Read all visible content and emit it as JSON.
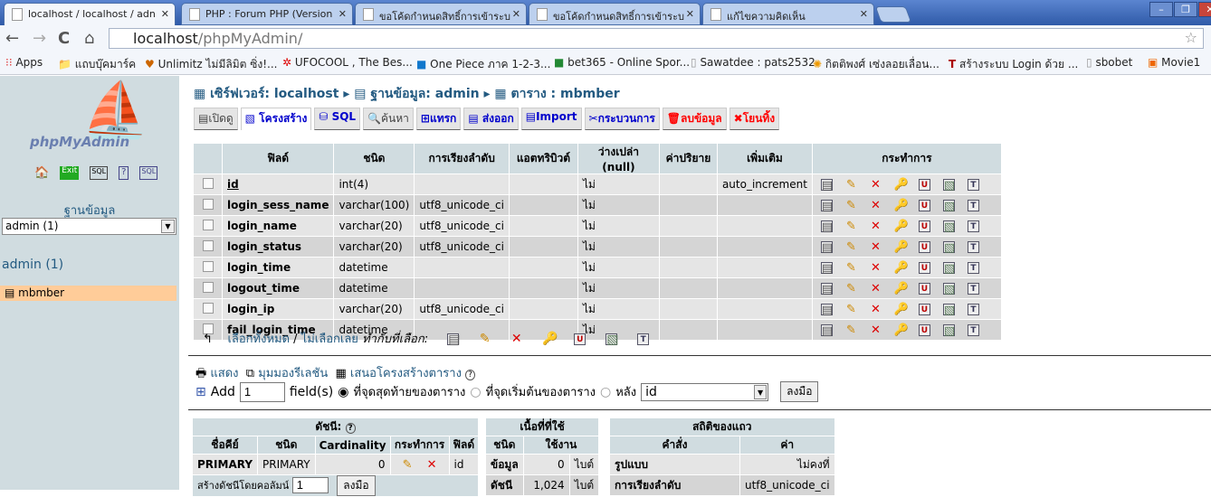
{
  "browser": {
    "tabs": [
      {
        "title": "localhost / localhost / adn",
        "active": true
      },
      {
        "title": "PHP : Forum PHP (Version"
      },
      {
        "title": "ขอโค้ดกำหนดสิทธิ์การเข้าระบ"
      },
      {
        "title": "ขอโค้ดกำหนดสิทธิ์การเข้าระบ"
      },
      {
        "title": "แก้ไขความคิดเห็น"
      }
    ],
    "url_host": "localhost",
    "url_path": "/phpMyAdmin/",
    "bookmarks": [
      "Apps",
      "แถบบุ๊คมาร์ค",
      "Unlimitz ไม่มีลิมิต ซิ่ง!...",
      "UFOCOOL , The Bes...",
      "One Piece ภาค 1-2-3...",
      "bet365 - Online Spor...",
      "Sawatdee : pats2532",
      "กิตติพงศ์ เซ่งลอยเลื่อน...",
      "สร้างระบบ Login ด้วย ...",
      "sbobet",
      "Movie1"
    ]
  },
  "sidebar": {
    "logo": "phpMyAdmin",
    "db_label": "ฐานข้อมูล",
    "db_select": "admin (1)",
    "db_heading": "admin (1)",
    "tables": [
      "mbmber"
    ]
  },
  "breadcrumb": {
    "server": "เซิร์ฟเวอร์: localhost",
    "database": "ฐานข้อมูล: admin",
    "table": "ตาราง : mbmber"
  },
  "tabs": [
    "เปิดดู",
    "โครงสร้าง",
    "SQL",
    "ค้นหา",
    "แทรก",
    "ส่งออก",
    "Import",
    "กระบวนการ",
    "ลบข้อมูล",
    "โยนทิ้ง"
  ],
  "structure": {
    "headers": [
      "ฟิลด์",
      "ชนิด",
      "การเรียงลำดับ",
      "แอตทริบิวต์",
      "ว่างเปล่า (null)",
      "ค่าปริยาย",
      "เพิ่มเติม",
      "กระทำการ"
    ],
    "rows": [
      {
        "field": "id",
        "type": "int(4)",
        "collation": "",
        "attributes": "",
        "null": "ไม่",
        "default": "",
        "extra": "auto_increment"
      },
      {
        "field": "login_sess_name",
        "type": "varchar(100)",
        "collation": "utf8_unicode_ci",
        "attributes": "",
        "null": "ไม่",
        "default": "",
        "extra": ""
      },
      {
        "field": "login_name",
        "type": "varchar(20)",
        "collation": "utf8_unicode_ci",
        "attributes": "",
        "null": "ไม่",
        "default": "",
        "extra": ""
      },
      {
        "field": "login_status",
        "type": "varchar(20)",
        "collation": "utf8_unicode_ci",
        "attributes": "",
        "null": "ไม่",
        "default": "",
        "extra": ""
      },
      {
        "field": "login_time",
        "type": "datetime",
        "collation": "",
        "attributes": "",
        "null": "ไม่",
        "default": "",
        "extra": ""
      },
      {
        "field": "logout_time",
        "type": "datetime",
        "collation": "",
        "attributes": "",
        "null": "ไม่",
        "default": "",
        "extra": ""
      },
      {
        "field": "login_ip",
        "type": "varchar(20)",
        "collation": "utf8_unicode_ci",
        "attributes": "",
        "null": "ไม่",
        "default": "",
        "extra": ""
      },
      {
        "field": "fail_login_time",
        "type": "datetime",
        "collation": "",
        "attributes": "",
        "null": "ไม่",
        "default": "",
        "extra": ""
      }
    ]
  },
  "check_all": "เลือกทั้งหมด",
  "sep": " / ",
  "uncheck_all": "ไม่เลือกเลย",
  "with_selected": "ทำกับที่เลือก:",
  "links": {
    "print": "แสดง",
    "relation": "มุมมองรีเลชัน",
    "propose": "เสนอโครงสร้างตาราง"
  },
  "add": {
    "label": "Add",
    "count": "1",
    "fields": "field(s)",
    "opt_end": "ที่จุดสุดท้ายของตาราง",
    "opt_begin": "ที่จุดเริ่มต้นของตาราง",
    "opt_after": "หลัง",
    "after_field": "id",
    "go": "ลงมือ"
  },
  "indexes": {
    "title": "ดัชนี:",
    "headers": [
      "ชื่อคีย์",
      "ชนิด",
      "Cardinality",
      "กระทำการ",
      "ฟิลด์"
    ],
    "row": {
      "key": "PRIMARY",
      "type": "PRIMARY",
      "cardinality": "0",
      "field": "id"
    },
    "create_label": "สร้างดัชนีโดยคอลัมน์",
    "create_count": "1",
    "go": "ลงมือ"
  },
  "space": {
    "title": "เนื้อที่ที่ใช้",
    "headers": [
      "ชนิด",
      "ใช้งาน"
    ],
    "rows": [
      {
        "type": "ข้อมูล",
        "value": "0",
        "unit": "ไบต์"
      },
      {
        "type": "ดัชนี",
        "value": "1,024",
        "unit": "ไบต์"
      }
    ]
  },
  "rowstats": {
    "title": "สถิติของแถว",
    "headers": [
      "คำสั่ง",
      "ค่า"
    ],
    "rows": [
      {
        "k": "รูปแบบ",
        "v": "ไม่คงที่"
      },
      {
        "k": "การเรียงลำดับ",
        "v": "utf8_unicode_ci"
      }
    ]
  }
}
